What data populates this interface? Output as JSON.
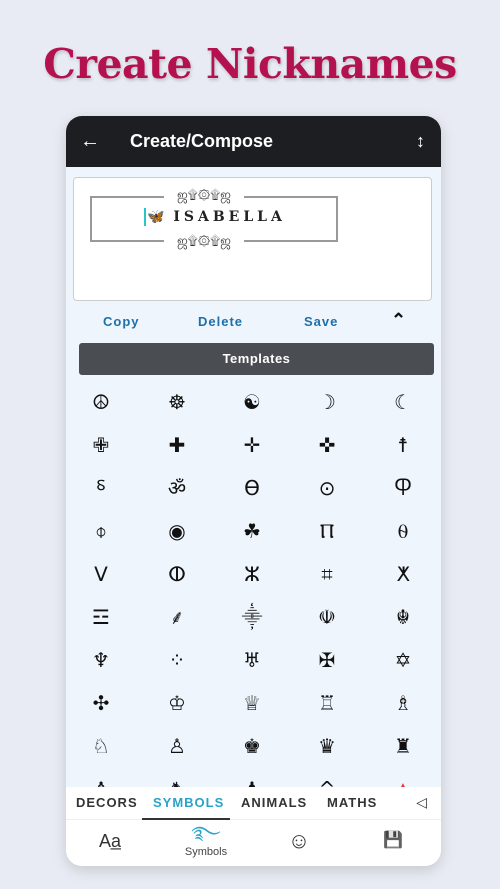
{
  "promo_title": "Create Nicknames",
  "appbar": {
    "title": "Create/Compose",
    "back_icon": "arrow-left-icon",
    "sort_icon": "vertical-arrows-icon"
  },
  "editor": {
    "ornament_top": "ஜ۩۞۩ஜ",
    "ornament_bottom": "ஜ۩۞۩ஜ",
    "decoration": "🦋",
    "name": "ISABELLA"
  },
  "actions": {
    "copy": "Copy",
    "delete": "Delete",
    "save": "Save"
  },
  "templates_label": "Templates",
  "symbols": [
    [
      "☮",
      "☸",
      "☯",
      "☽",
      "☾"
    ],
    [
      "✙",
      "✚",
      "✛",
      "✜",
      "☨"
    ],
    [
      "⸹",
      "ॐ",
      "Ѳ",
      "⊙",
      "Ⴔ"
    ],
    [
      "⌽",
      "◉",
      "☘",
      "Ⲡ",
      "⍬"
    ],
    [
      "ⴸ",
      "ⵀ",
      "ⵣ",
      "⌗",
      "ⵅ"
    ],
    [
      "☲",
      "⸙",
      "⸎",
      "☫",
      "☬"
    ],
    [
      "♆",
      "⁘",
      "♅",
      "✠",
      "✡"
    ],
    [
      "✣",
      "♔",
      "♕",
      "♖",
      "♗"
    ],
    [
      "♘",
      "♙",
      "♚",
      "♛",
      "♜"
    ],
    [
      "♝",
      "♞",
      "♟",
      "^",
      "▲"
    ]
  ],
  "accent_red": "#e53935",
  "category_tabs": [
    "DECORS",
    "SYMBOLS",
    "ANIMALS",
    "MATHS"
  ],
  "active_tab": "SYMBOLS",
  "accent": "#2aa3c9",
  "bottom_nav": [
    {
      "icon": "font-icon",
      "glyph": "Aa̲"
    },
    {
      "icon": "swirl-icon",
      "glyph": "࿐",
      "label": "Symbols"
    },
    {
      "icon": "smiley-icon",
      "glyph": "☺"
    },
    {
      "icon": "save-icon",
      "glyph": "💾"
    }
  ]
}
